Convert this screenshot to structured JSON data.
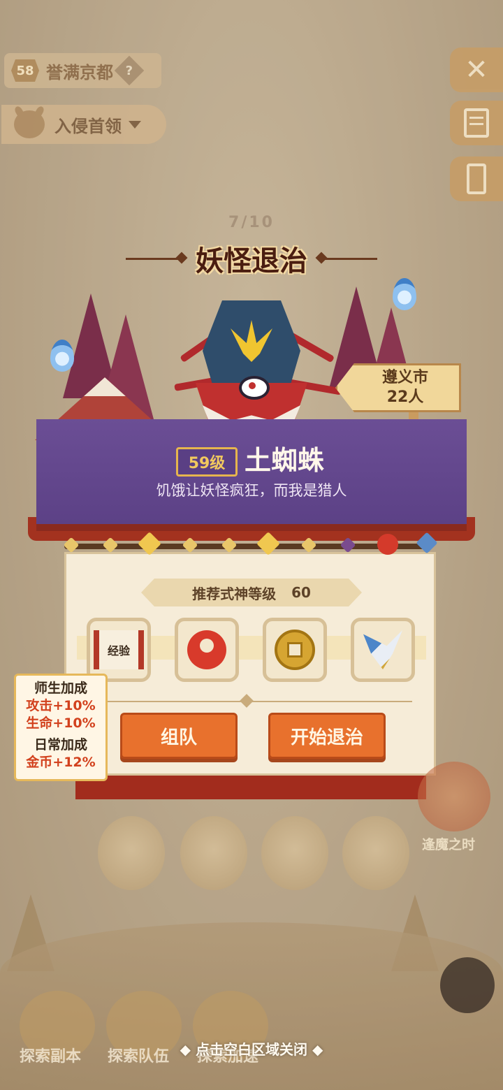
{
  "header": {
    "player_level": "58",
    "area_name": "誉满京都",
    "help_icon": "question-icon",
    "boss_dropdown_label": "入侵首领"
  },
  "side_buttons": [
    "close-icon",
    "document-icon",
    "card-icon"
  ],
  "progress": {
    "text": "7/10",
    "current": 7,
    "total": 10
  },
  "title": "妖怪退治",
  "location": {
    "city": "遵义市",
    "count": "22人"
  },
  "boss": {
    "level": "59级",
    "name": "土蜘蛛",
    "quote": "饥饿让妖怪疯狂，而我是猎人"
  },
  "recommend": {
    "label": "推荐式神等级",
    "value": "60"
  },
  "rewards": [
    {
      "name": "exp-scroll",
      "label": "经验"
    },
    {
      "name": "magatama-icon",
      "label": ""
    },
    {
      "name": "coin-icon",
      "label": ""
    },
    {
      "name": "spirit-icon",
      "label": ""
    }
  ],
  "buttons": {
    "team": "组队",
    "start": "开始退治"
  },
  "bonus": {
    "mentor_title": "师生加成",
    "attack": "攻击+10%",
    "life": "生命+10%",
    "daily_title": "日常加成",
    "gold": "金币+12%"
  },
  "event": {
    "label": "逢魔之时"
  },
  "bottom_nav": {
    "explore_dungeon": "探索副本",
    "explore_team": "探索队伍",
    "explore_bonus": "探索加速"
  },
  "close_hint": "◆ 点击空白区域关闭 ◆",
  "colors": {
    "accent": "#e8712d",
    "banner": "#5c4186",
    "panel": "#f6ecd8"
  }
}
